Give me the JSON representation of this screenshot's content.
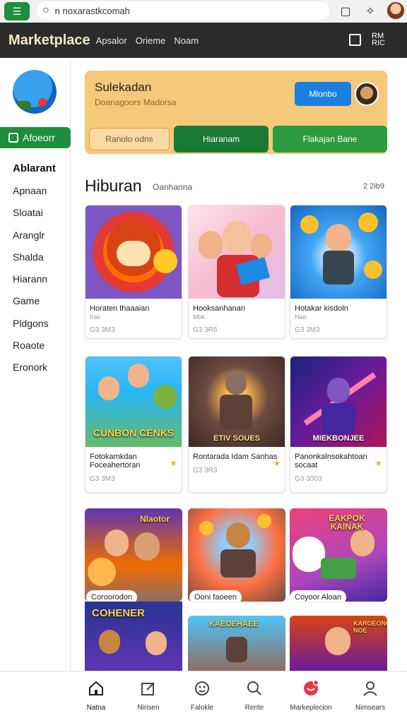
{
  "browser": {
    "url": "n noxarastkcomah",
    "menu_icon": "menu-icon",
    "search_icon": "search-icon",
    "reader_icon": "reader-icon",
    "extension_icon": "puzzle-icon"
  },
  "header": {
    "title": "Marketplace",
    "nav": [
      "Apsalor",
      "Orieme",
      "Noam"
    ],
    "right_code": "RM RIC"
  },
  "sidebar": {
    "button_label": "Afoeorr",
    "heading": "Ablarant",
    "items": [
      "Apnaan",
      "Sloatai",
      "Aranglr",
      "Shalda",
      "Hiarann",
      "Game",
      "Pldgons",
      "Roaote",
      "Eronork"
    ]
  },
  "banner": {
    "title": "Sulekadan",
    "subtitle": "Doanagoors Madorsa",
    "cta": "Mlonbo",
    "pills": [
      "Ranolo odns",
      "Hiaranam",
      "Flakajan Bane"
    ],
    "colors": {
      "banner_bg": "#f6c87a",
      "cta": "#1a7fe0",
      "pill_dark": "#1a7a35",
      "pill_green": "#2c9a3e"
    }
  },
  "section": {
    "title": "Hiburan",
    "subtitle": "Oanhanna",
    "count": "2 2ib9"
  },
  "cards": [
    {
      "name": "Horaten thaaaian",
      "sub": "Iras",
      "price": "G3 3M3"
    },
    {
      "name": "Hooksanhanan",
      "sub": "Mbk",
      "price": "G3 3R6"
    },
    {
      "name": "Hotakar kisdoln",
      "sub": "Nao",
      "price": "G3 3M3"
    },
    {
      "name": "Fotokamkdan Foceahertoran",
      "overlay": "CUNBON CENKS",
      "price": "G3 3M3"
    },
    {
      "name": "Rontarada Idam Sanhas",
      "overlay": "ETIV SOUES",
      "price": "G3 3R3"
    },
    {
      "name": "Panonkalnsokahtoan socaat",
      "overlay": "MIEKBONJEE",
      "price": "G3 3003"
    },
    {
      "overlay": "Nlaotor",
      "tag": "Coroorodon"
    },
    {
      "tag": "Ooni faoeen"
    },
    {
      "overlay": "EAKPOK KAINAK",
      "tag": "Coyoor Aloan"
    },
    {
      "overlay": "COHENER"
    },
    {
      "overlay": "KAEOEHAEE"
    },
    {
      "overlay": "KAROEONG NOE"
    }
  ],
  "bottom_nav": [
    {
      "label": "Natna",
      "icon": "home-icon"
    },
    {
      "label": "Nirisen",
      "icon": "edit-icon"
    },
    {
      "label": "Falokle",
      "icon": "game-icon"
    },
    {
      "label": "Rente",
      "icon": "search-icon"
    },
    {
      "label": "Markeplecion",
      "icon": "market-icon",
      "badge": true
    },
    {
      "label": "Nimsears",
      "icon": "profile-icon"
    }
  ]
}
